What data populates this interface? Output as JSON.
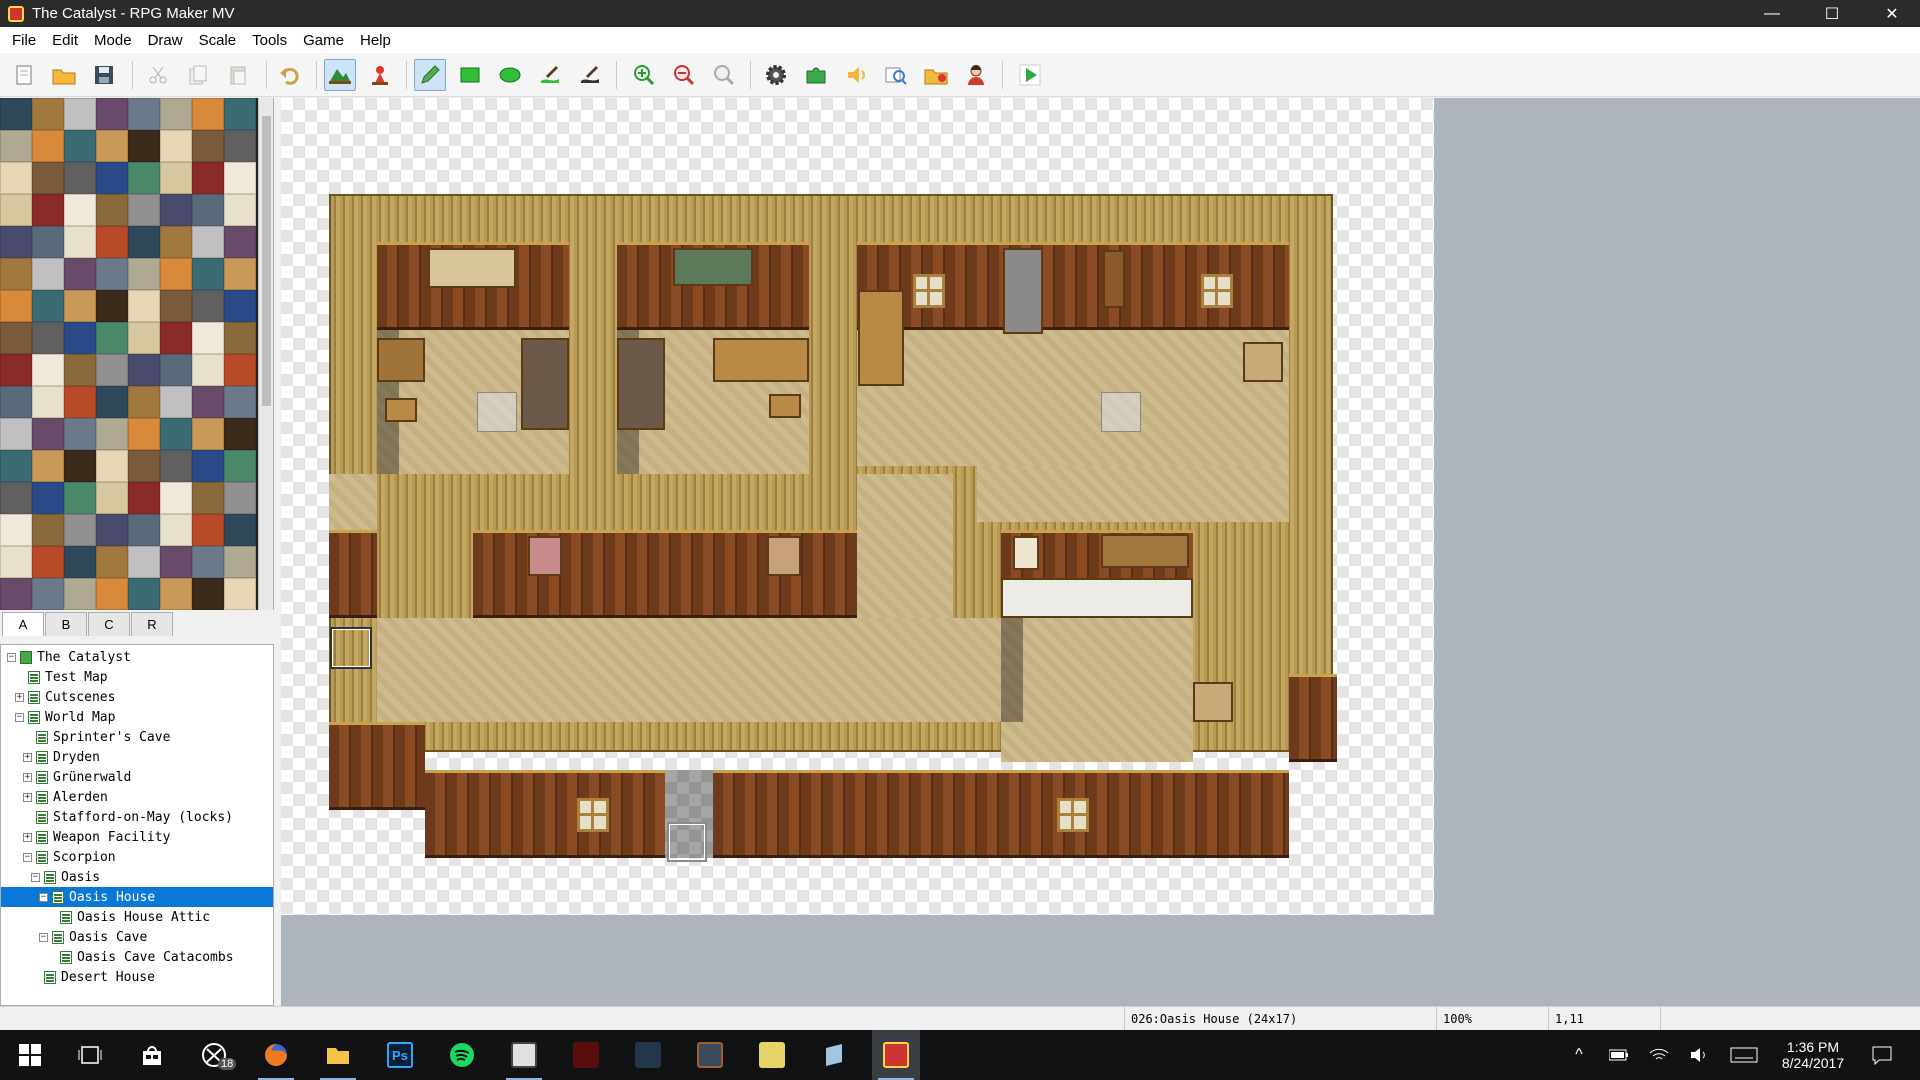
{
  "window": {
    "title": "The Catalyst - RPG Maker MV",
    "minimize_glyph": "—",
    "maximize_glyph": "☐",
    "close_glyph": "✕"
  },
  "menu": [
    "File",
    "Edit",
    "Mode",
    "Draw",
    "Scale",
    "Tools",
    "Game",
    "Help"
  ],
  "toolbar": {
    "buttons": [
      "new-project",
      "open-project",
      "save-project",
      "cut",
      "copy",
      "paste",
      "undo",
      "map-mode",
      "event-mode",
      "pencil",
      "rectangle",
      "ellipse",
      "fill",
      "shadow-pen",
      "zoom-in",
      "zoom-out",
      "actual-size",
      "database",
      "plugin-manager",
      "sound-test",
      "event-searcher",
      "resource-manager",
      "character-generator",
      "playtest"
    ],
    "active": [
      "map-mode",
      "pencil"
    ]
  },
  "tileset_tabs": [
    "A",
    "B",
    "C",
    "R"
  ],
  "selected_tab": "A",
  "map_tree": [
    {
      "label": "The Catalyst",
      "depth": 0,
      "expander": "−",
      "root": true
    },
    {
      "label": "Test Map",
      "depth": 1,
      "expander": ""
    },
    {
      "label": "Cutscenes",
      "depth": 1,
      "expander": "+"
    },
    {
      "label": "World Map",
      "depth": 1,
      "expander": "−"
    },
    {
      "label": "Sprinter's Cave",
      "depth": 2,
      "expander": ""
    },
    {
      "label": "Dryden",
      "depth": 2,
      "expander": "+"
    },
    {
      "label": "Grünerwald",
      "depth": 2,
      "expander": "+"
    },
    {
      "label": "Alerden",
      "depth": 2,
      "expander": "+"
    },
    {
      "label": "Stafford-on-May (locks)",
      "depth": 2,
      "expander": ""
    },
    {
      "label": "Weapon Facility",
      "depth": 2,
      "expander": "+"
    },
    {
      "label": "Scorpion",
      "depth": 2,
      "expander": "−"
    },
    {
      "label": "Oasis",
      "depth": 3,
      "expander": "−"
    },
    {
      "label": "Oasis House",
      "depth": 4,
      "expander": "−",
      "selected": true
    },
    {
      "label": "Oasis House Attic",
      "depth": 5,
      "expander": ""
    },
    {
      "label": "Oasis Cave",
      "depth": 4,
      "expander": "−"
    },
    {
      "label": "Oasis Cave Catacombs",
      "depth": 5,
      "expander": ""
    },
    {
      "label": "Desert House",
      "depth": 3,
      "expander": ""
    }
  ],
  "status": {
    "map_info": "026:Oasis House (24x17)",
    "zoom": "100%",
    "coords": "1,11"
  },
  "taskbar": {
    "apps": [
      "start",
      "task-view",
      "store",
      "xbox",
      "firefox",
      "file-explorer",
      "photoshop",
      "spotify",
      "steam-game-1",
      "steam-game-2",
      "steam-game-3",
      "steam-game-4",
      "steam-game-5",
      "notes",
      "rpg-maker-mv"
    ],
    "xbox_badge": "18",
    "time": "1:36 PM",
    "date": "8/24/2017"
  },
  "colors": {
    "selection": "#0a78d7",
    "floor": "#cdbb8e",
    "wall_top": "#b79a55",
    "wall_face": "#6d3a1c",
    "canvas_bg": "#aeb4bc"
  }
}
